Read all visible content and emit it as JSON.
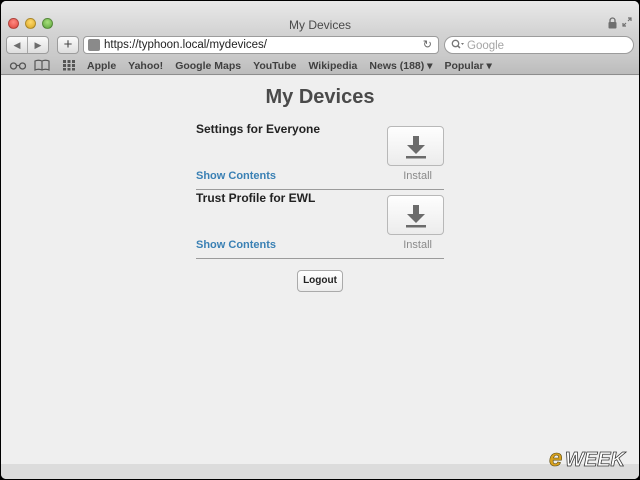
{
  "window": {
    "title": "My Devices"
  },
  "toolbar": {
    "back": "◀",
    "forward": "▶",
    "new_tab": "+",
    "url": "https://typhoon.local/mydevices/",
    "reload": "↻",
    "search_placeholder": "Google"
  },
  "bookmarks": [
    "Apple",
    "Yahoo!",
    "Google Maps",
    "YouTube",
    "Wikipedia",
    "News (188) ▾",
    "Popular ▾"
  ],
  "main": {
    "title": "My Devices",
    "profiles": [
      {
        "name": "Settings for Everyone",
        "link": "Show Contents",
        "action": "Install"
      },
      {
        "name": "Trust Profile for EWL",
        "link": "Show Contents",
        "action": "Install"
      }
    ],
    "logout_label": "Logout"
  },
  "watermark": "eWEEK",
  "colors": {
    "link": "#3a80b4",
    "title_text": "#4a4a4a",
    "accent": "#d9a21f"
  }
}
